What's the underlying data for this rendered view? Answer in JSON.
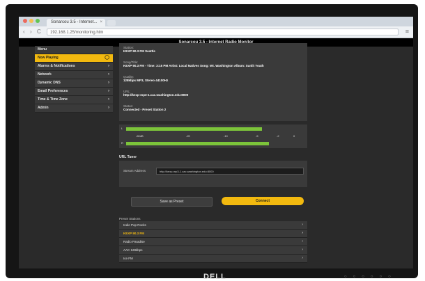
{
  "browser": {
    "tab_title": "Sonarcou 3.5 - Internet...",
    "tab_close": "×",
    "url": "192.168.1.25/monitoring.htm",
    "back_icon": "‹",
    "forward_icon": "›",
    "reload_icon": "C",
    "menu_icon": "≡"
  },
  "header": {
    "title": "Sonarcou 3.5 - Internet Radio Monitor"
  },
  "sidebar": {
    "items": [
      {
        "label": "Menu",
        "arrow": ""
      },
      {
        "label": "Now Playing",
        "arrow": "◯"
      },
      {
        "label": "Alarms & Notifications",
        "arrow": "›"
      },
      {
        "label": "Network",
        "arrow": "›"
      },
      {
        "label": "Dynamic DNS",
        "arrow": "›"
      },
      {
        "label": "Email Preferences",
        "arrow": "›"
      },
      {
        "label": "Time & Time Zone",
        "arrow": "›"
      },
      {
        "label": "Admin",
        "arrow": "›"
      }
    ]
  },
  "info": {
    "station_label": "Station:",
    "station_value": "KEXP 90.3 FM Seattle",
    "song_label": "Song/Title:",
    "song_value": "KEXP 90.3 FM - Time: 3:15 PM Artist: Local Natives Song: Wt. Washington Album: Sunlit Youth",
    "quality_label": "Quality:",
    "quality_value": "128kbps MP3, Stereo 44100Hz",
    "url_label": "URL:",
    "url_value": "http://kexp-mp3-1.cac.washington.edu:8000",
    "status_label": "Status:",
    "status_value": "Connected - Preset Station 2"
  },
  "meter": {
    "left_label": "L",
    "right_label": "R",
    "left_level": 0.78,
    "right_level": 0.82,
    "scale": [
      "-60dB",
      "-20",
      "-10",
      "-5",
      "-2",
      "0"
    ]
  },
  "tuner": {
    "heading": "URL Tuner",
    "stream_label": "Stream Address",
    "stream_value": "http://kexp-mp3-1.cac.washington.edu:8000",
    "save_label": "Save as Preset",
    "connect_label": "Connect"
  },
  "presets": {
    "heading": "Preset Stations",
    "items": [
      {
        "label": "Indie Pop Rocks",
        "arrow": "›"
      },
      {
        "label": "KEXP 90.3 FM",
        "arrow": "›"
      },
      {
        "label": "Radio Paradise",
        "arrow": "›"
      },
      {
        "label": "AAC 128kbps",
        "arrow": "›"
      },
      {
        "label": "Ice FM",
        "arrow": "›"
      }
    ]
  },
  "monitor": {
    "brand": "DELL",
    "controls": [
      "○",
      "○",
      "○",
      "○",
      "○",
      "○"
    ]
  },
  "colors": {
    "accent": "#f2b90f",
    "meter_green": "#7cc43a",
    "panel": "#3a3a3a",
    "header": "#000000"
  }
}
